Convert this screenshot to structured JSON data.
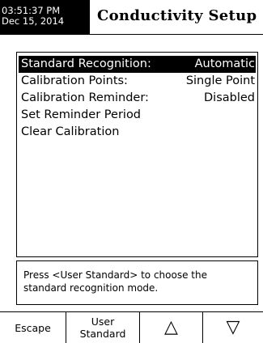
{
  "header": {
    "time": "03:51:37 PM",
    "date": "Dec 15, 2014",
    "title": "Conductivity Setup"
  },
  "menu": {
    "items": [
      {
        "label": "Standard Recognition:",
        "value": "Automatic",
        "selected": true
      },
      {
        "label": "Calibration Points:",
        "value": "Single Point",
        "selected": false
      },
      {
        "label": "Calibration Reminder:",
        "value": "Disabled",
        "selected": false
      },
      {
        "label": "Set Reminder Period",
        "value": "",
        "selected": false
      },
      {
        "label": "Clear Calibration",
        "value": "",
        "selected": false
      }
    ]
  },
  "help": {
    "text": "Press <User Standard> to choose the standard recognition mode."
  },
  "softkeys": {
    "escape": "Escape",
    "user_standard": "User Standard",
    "up": "△",
    "down": "▽"
  }
}
